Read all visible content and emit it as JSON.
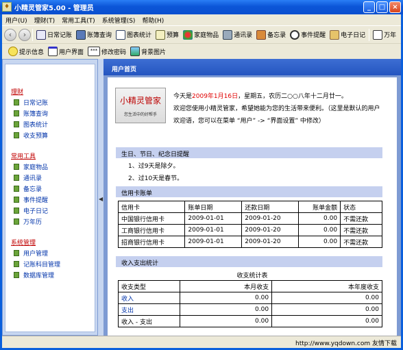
{
  "window": {
    "title": "小精灵管家5.00   -  管理员"
  },
  "menu": [
    "用户(U)",
    "理财(T)",
    "常用工具(T)",
    "系统管理(S)",
    "帮助(H)"
  ],
  "toolbar1": [
    "日常记账",
    "账簿查询",
    "图表统计",
    "预算",
    "家庭物品",
    "通讯录",
    "备忘录",
    "事件提醒",
    "电子日记",
    "万年"
  ],
  "toolbar2": [
    "提示信息",
    "用户界面",
    "修改密码",
    "背景图片"
  ],
  "sidebar": {
    "groups": [
      {
        "title": "理财",
        "items": [
          "日常记账",
          "账簿查询",
          "图表统计",
          "收支预算"
        ]
      },
      {
        "title": "常用工具",
        "items": [
          "家庭物品",
          "通讯录",
          "备忘录",
          "事件提醒",
          "电子日记",
          "万年历"
        ]
      },
      {
        "title": "系统管理",
        "items": [
          "用户管理",
          "记账科目管理",
          "数据库管理"
        ]
      }
    ]
  },
  "main": {
    "header": "用户首页",
    "logo": {
      "title": "小精灵管家",
      "subtitle": "您生活中的好帮手"
    },
    "today_prefix": "今天是",
    "today_date": "2009年1月16日",
    "today_suffix": "，星期五，农历二○○八年十二月廿一。",
    "welcome1": "欢迎您使用小精灵管家，希望她能为您的生活带来便利。（这里是默认的用户",
    "welcome2": "欢迎语，您可以在菜单 “用户” -> “界面设置” 中修改）",
    "reminder_title": "生日、节日、纪念日提醒",
    "reminders": [
      "1、过9天是除夕。",
      "2、过10天是春节。"
    ],
    "card_title": "信用卡账单",
    "card_headers": [
      "信用卡",
      "账单日期",
      "还款日期",
      "账单金额",
      "状态"
    ],
    "card_rows": [
      [
        "中国银行信用卡",
        "2009-01-01",
        "2009-01-20",
        "0.00",
        "不需还款"
      ],
      [
        "工商银行信用卡",
        "2009-01-01",
        "2009-01-20",
        "0.00",
        "不需还款"
      ],
      [
        "招商银行信用卡",
        "2009-01-01",
        "2009-01-20",
        "0.00",
        "不需还款"
      ]
    ],
    "stats_title": "收入支出统计",
    "stats_caption": "收支统计表",
    "stats_headers": [
      "收支类型",
      "本月收支",
      "本年度收支"
    ],
    "stats_rows": [
      [
        "收入",
        "0.00",
        "0.00"
      ],
      [
        "支出",
        "0.00",
        "0.00"
      ],
      [
        "收入 - 支出",
        "0.00",
        "0.00"
      ]
    ]
  },
  "watermark": "http://www.yqdown.com 友情下载"
}
